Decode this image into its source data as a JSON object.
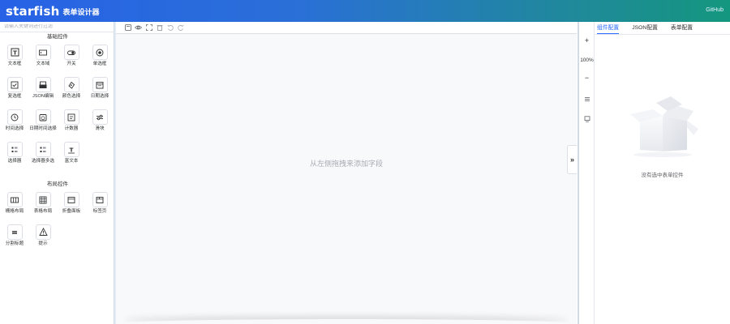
{
  "header": {
    "brand": "starfish",
    "subtitle": "表单设计器",
    "github": "GitHub"
  },
  "search": {
    "placeholder": "请输入关键词进行过滤"
  },
  "groups": {
    "basic": "基础控件",
    "layout": "布局控件"
  },
  "basic_components": [
    {
      "label": "文本框",
      "icon": "text-input-icon"
    },
    {
      "label": "文本域",
      "icon": "textarea-icon"
    },
    {
      "label": "开关",
      "icon": "switch-icon"
    },
    {
      "label": "单选框",
      "icon": "radio-icon"
    },
    {
      "label": "复选框",
      "icon": "checkbox-icon"
    },
    {
      "label": "JSON编辑",
      "icon": "json-editor-icon"
    },
    {
      "label": "颜色选择",
      "icon": "color-picker-icon"
    },
    {
      "label": "日期选择",
      "icon": "date-picker-icon"
    },
    {
      "label": "时间选择",
      "icon": "time-picker-icon"
    },
    {
      "label": "日期时间选择",
      "icon": "datetime-picker-icon"
    },
    {
      "label": "计数器",
      "icon": "counter-icon"
    },
    {
      "label": "滑块",
      "icon": "slider-icon"
    },
    {
      "label": "选择器",
      "icon": "select-icon"
    },
    {
      "label": "选择器多选",
      "icon": "multi-select-icon"
    },
    {
      "label": "富文本",
      "icon": "rich-text-icon"
    }
  ],
  "layout_components": [
    {
      "label": "栅格布局",
      "icon": "grid-layout-icon"
    },
    {
      "label": "表格布局",
      "icon": "table-layout-icon"
    },
    {
      "label": "折叠面板",
      "icon": "collapse-panel-icon"
    },
    {
      "label": "标签页",
      "icon": "tabs-icon"
    },
    {
      "label": "分割标题",
      "icon": "divider-icon"
    },
    {
      "label": "提示",
      "icon": "alert-icon"
    }
  ],
  "toolbar": {
    "icons": [
      "save-icon",
      "preview-icon",
      "fullscreen-icon",
      "delete-icon",
      "undo-icon",
      "redo-icon"
    ]
  },
  "canvas": {
    "empty_text": "从左侧拖拽来添加字段",
    "collapse_label": "»"
  },
  "side_tools": {
    "zoom_in": "+",
    "zoom_level": "100%",
    "zoom_out": "−"
  },
  "right_panel": {
    "tabs": [
      "组件配置",
      "JSON配置",
      "表单配置"
    ],
    "active_tab": 0,
    "empty_text": "没有选中表单控件"
  },
  "colors": {
    "accent": "#2a6cff",
    "header_start": "#2762e6",
    "header_end": "#14977f"
  }
}
